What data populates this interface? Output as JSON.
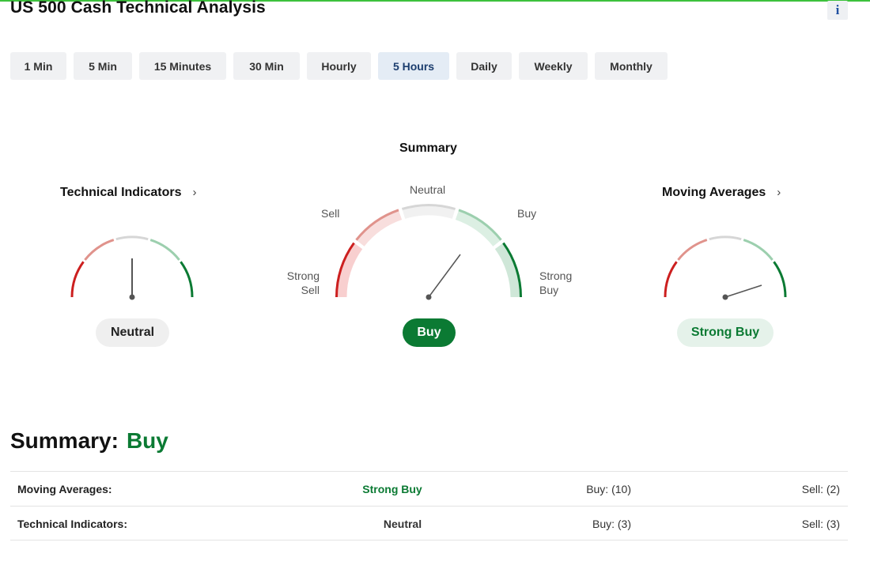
{
  "page": {
    "title": "US 500 Cash Technical Analysis",
    "info_label": "i"
  },
  "timeframes": {
    "items": [
      "1 Min",
      "5 Min",
      "15 Minutes",
      "30 Min",
      "Hourly",
      "5 Hours",
      "Daily",
      "Weekly",
      "Monthly"
    ],
    "active": "5 Hours"
  },
  "gauges": {
    "technical_indicators": {
      "title": "Technical Indicators",
      "arrow": "›",
      "signal": "Neutral"
    },
    "summary": {
      "title": "Summary",
      "signal": "Buy",
      "labels": {
        "strong_sell_1": "Strong",
        "strong_sell_2": "Sell",
        "sell": "Sell",
        "neutral": "Neutral",
        "buy": "Buy",
        "strong_buy_1": "Strong",
        "strong_buy_2": "Buy"
      }
    },
    "moving_averages": {
      "title": "Moving Averages",
      "arrow": "›",
      "signal": "Strong Buy"
    }
  },
  "summary": {
    "label": "Summary:",
    "value": "Buy",
    "rows": [
      {
        "name": "Moving Averages:",
        "signal": "Strong Buy",
        "buy": "Buy: (10)",
        "sell": "Sell: (2)"
      },
      {
        "name": "Technical Indicators:",
        "signal": "Neutral",
        "buy": "Buy: (3)",
        "sell": "Sell: (3)"
      }
    ]
  },
  "colors": {
    "strong_sell": "#cc1f1f",
    "sell": "#e0938c",
    "neutral": "#d6d6d6",
    "buy": "#9ccfae",
    "strong_buy": "#0b7a33",
    "accent_green": "#0b7a33"
  }
}
